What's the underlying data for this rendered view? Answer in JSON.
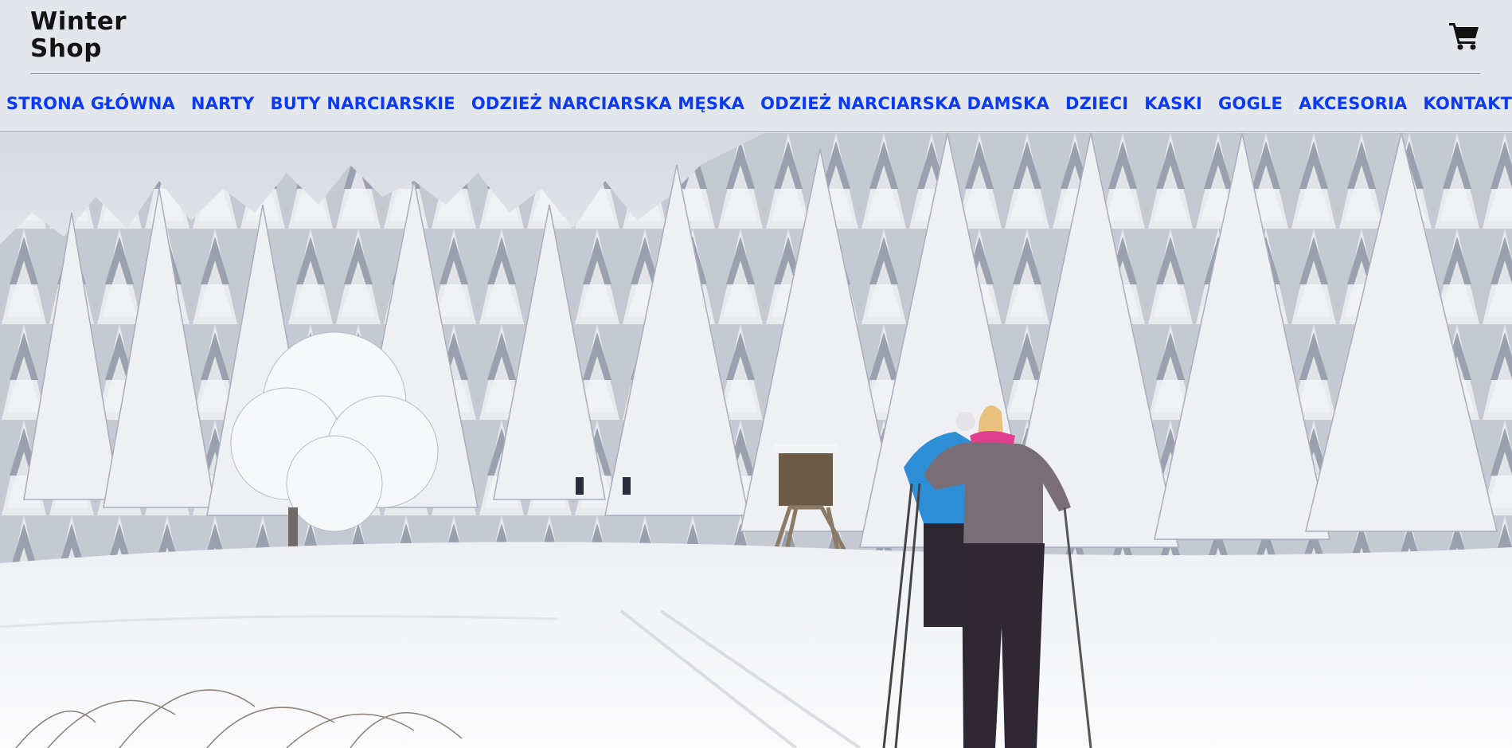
{
  "header": {
    "logo_line1": "Winter",
    "logo_line2": "Shop",
    "cart_icon": "shopping-cart-icon"
  },
  "nav": {
    "items": [
      {
        "label": "STRONA GŁÓWNA"
      },
      {
        "label": "NARTY"
      },
      {
        "label": "BUTY NARCIARSKIE"
      },
      {
        "label": "ODZIEŻ NARCIARSKA MĘSKA"
      },
      {
        "label": "ODZIEŻ NARCIARSKA DAMSKA"
      },
      {
        "label": "DZIECI"
      },
      {
        "label": "KASKI"
      },
      {
        "label": "GOGLE"
      },
      {
        "label": "AKCESORIA"
      },
      {
        "label": "KONTAKT"
      }
    ]
  },
  "colors": {
    "header_bg": "#e3e6ea",
    "nav_link": "#0a3af5",
    "logo_text": "#141414"
  }
}
